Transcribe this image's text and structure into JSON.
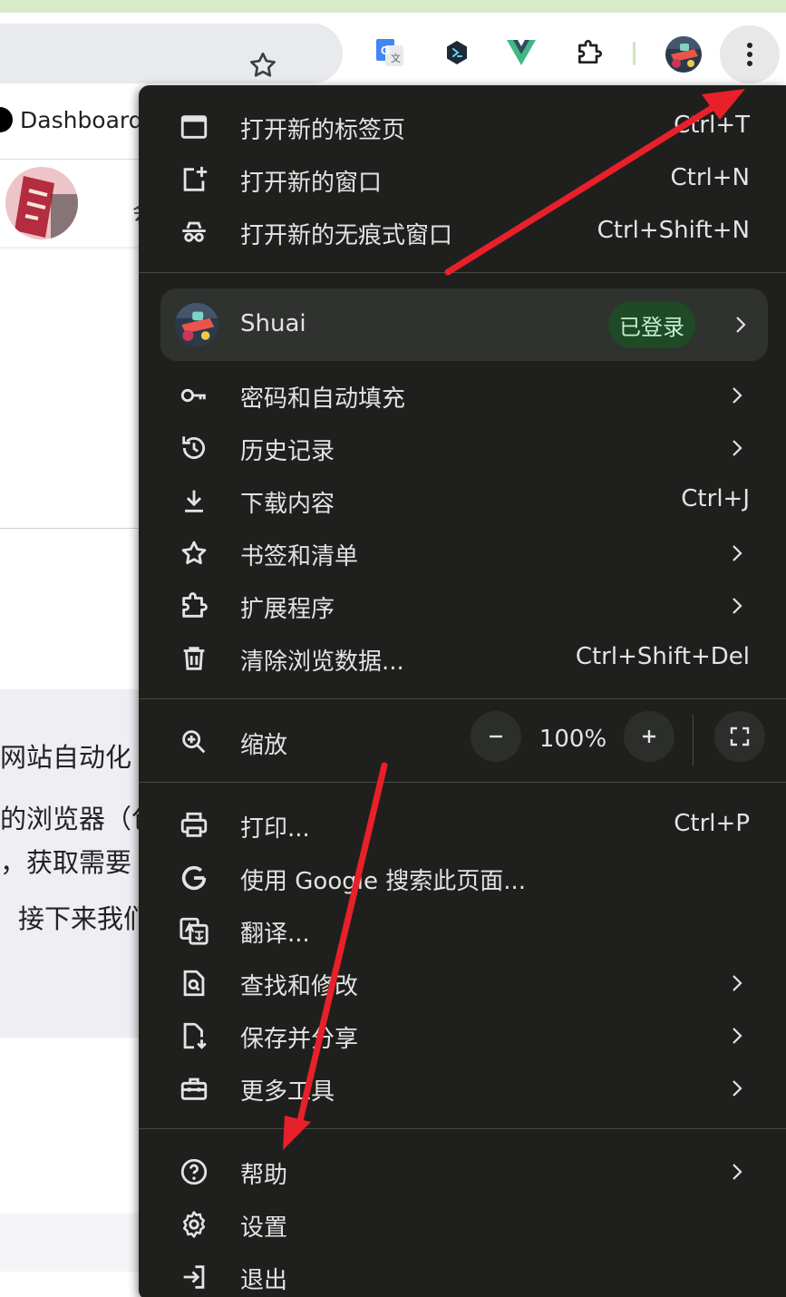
{
  "page": {
    "bookmark_label": "Dashboard",
    "header_char": "会",
    "text_lines": [
      "网站自动化",
      "的浏览器（包",
      "，获取需要",
      "接下来我们"
    ]
  },
  "menu": {
    "new_tab": {
      "label": "打开新的标签页",
      "shortcut": "Ctrl+T"
    },
    "new_window": {
      "label": "打开新的窗口",
      "shortcut": "Ctrl+N"
    },
    "incognito": {
      "label": "打开新的无痕式窗口",
      "shortcut": "Ctrl+Shift+N"
    },
    "profile": {
      "name": "Shuai",
      "badge": "已登录"
    },
    "passwords": {
      "label": "密码和自动填充"
    },
    "history": {
      "label": "历史记录"
    },
    "downloads": {
      "label": "下载内容",
      "shortcut": "Ctrl+J"
    },
    "bookmarks": {
      "label": "书签和清单"
    },
    "extensions": {
      "label": "扩展程序"
    },
    "clear_data": {
      "label": "清除浏览数据...",
      "shortcut": "Ctrl+Shift+Del"
    },
    "zoom": {
      "label": "缩放",
      "value": "100%",
      "minus": "−",
      "plus": "+"
    },
    "print": {
      "label": "打印...",
      "shortcut": "Ctrl+P"
    },
    "google_search": {
      "label": "使用 Google 搜索此页面..."
    },
    "translate": {
      "label": "翻译..."
    },
    "find": {
      "label": "查找和修改"
    },
    "save_share": {
      "label": "保存并分享"
    },
    "more_tools": {
      "label": "更多工具"
    },
    "help": {
      "label": "帮助"
    },
    "settings": {
      "label": "设置"
    },
    "exit": {
      "label": "退出"
    }
  },
  "colors": {
    "menu_bg": "#1f201e",
    "menu_text": "#e3e3e3",
    "arrow": "#e8202a",
    "signed_in_badge": "#1f4a25"
  }
}
